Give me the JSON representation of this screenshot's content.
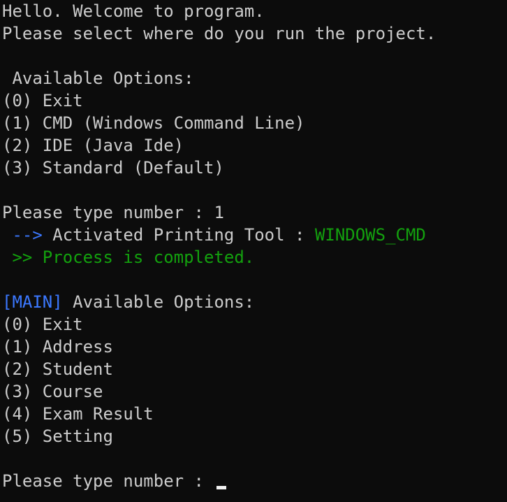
{
  "intro": {
    "line1": "Hello. Welcome to program.",
    "line2": "Please select where do you run the project."
  },
  "env_menu": {
    "title": " Available Options:",
    "options": [
      "(0) Exit",
      "(1) CMD (Windows Command Line)",
      "(2) IDE (Java Ide)",
      "(3) Standard (Default)"
    ]
  },
  "first_prompt": {
    "text": "Please type number : ",
    "input": "1"
  },
  "activation": {
    "arrow": " -->",
    "label": " Activated Printing Tool : ",
    "value": "WINDOWS_CMD"
  },
  "completion": {
    "text": " >> Process is completed."
  },
  "main_menu": {
    "tag": "[MAIN]",
    "title": " Available Options:",
    "options": [
      "(0) Exit",
      "(1) Address",
      "(2) Student",
      "(3) Course",
      "(4) Exam Result",
      "(5) Setting"
    ]
  },
  "second_prompt": {
    "text": "Please type number : "
  },
  "colors": {
    "background": "#0c0c0c",
    "text": "#cccccc",
    "green": "#13a10e",
    "blue": "#3b78ff",
    "cursor": "#f2f2f2"
  }
}
